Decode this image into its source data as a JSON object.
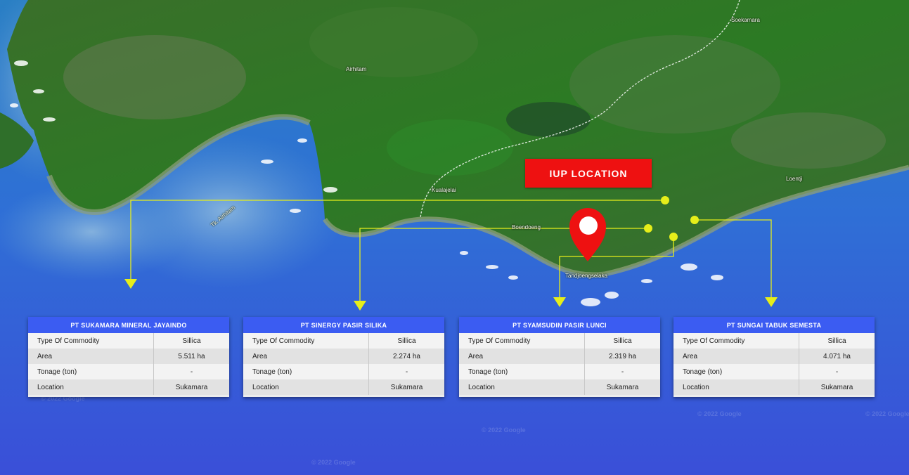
{
  "title": "IUP LOCATION",
  "place_names": {
    "soekamara": "Soekamara",
    "airhitam": "Airhitam",
    "kualajelai": "Kualajelai",
    "loentji": "Loentji",
    "tk_airhitam": "Tk. Airhitam",
    "boendoeng": "Boendoeng",
    "tandjoengselaka": "Tandjoengselaka"
  },
  "watermarks": [
    "© 2022 Google",
    "© 2022 Google",
    "© 2022 Google",
    "© 2022 Google",
    "© 2022 Google"
  ],
  "pin_icon": "location-pin-icon",
  "colors": {
    "banner": "#ee1111",
    "card_header": "#3b5cf2",
    "connector": "#e6ee1a",
    "pin": "#ee1111",
    "sea": "#3a55d8",
    "land": "#2d7a22"
  },
  "table_labels": {
    "commodity": "Type Of Commodity",
    "area": "Area",
    "tonage": "Tonage (ton)",
    "location": "Location"
  },
  "companies": [
    {
      "name": "PT SUKAMARA MINERAL JAYAINDO",
      "commodity": "Sillica",
      "area": "5.511 ha",
      "tonage": "-",
      "location": "Sukamara"
    },
    {
      "name": "PT SINERGY PASIR SILIKA",
      "commodity": "Sillica",
      "area": "2.274 ha",
      "tonage": "-",
      "location": "Sukamara"
    },
    {
      "name": "PT SYAMSUDIN PASIR LUNCI",
      "commodity": "Sillica",
      "area": "2.319 ha",
      "tonage": "-",
      "location": "Sukamara"
    },
    {
      "name": "PT SUNGAI TABUK SEMESTA",
      "commodity": "Sillica",
      "area": "4.071 ha",
      "tonage": "-",
      "location": "Sukamara"
    }
  ]
}
